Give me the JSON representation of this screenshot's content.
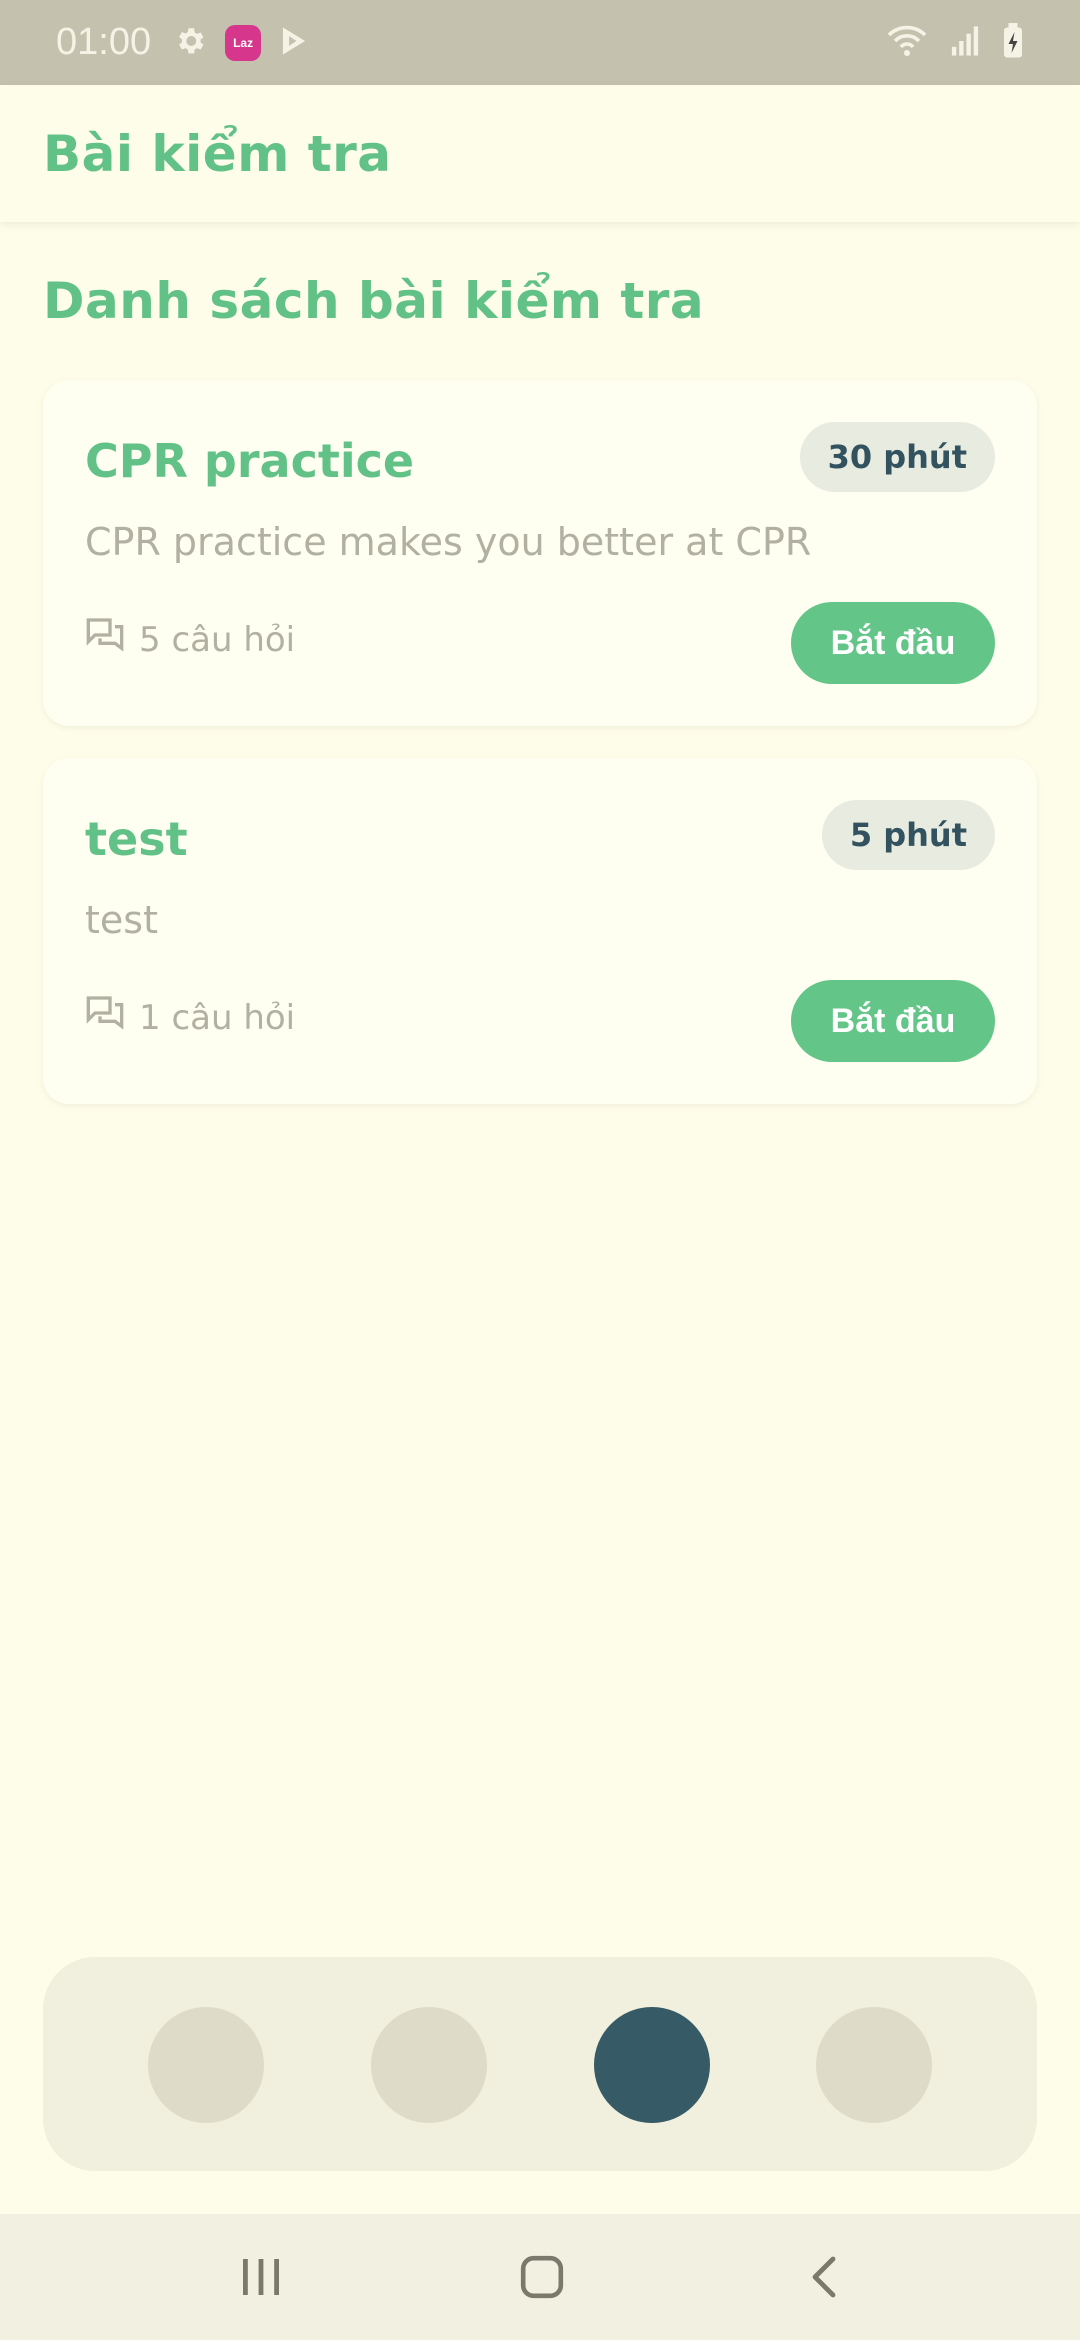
{
  "status_bar": {
    "time": "01:00",
    "left_icons": [
      "gear-icon",
      "lazada-app-icon",
      "play-store-icon"
    ],
    "lazada_label": "Laz",
    "right_icons": [
      "wifi-icon",
      "signal-icon",
      "battery-charging-icon"
    ]
  },
  "app_bar": {
    "title": "Bài kiểm tra"
  },
  "section": {
    "title": "Danh sách bài kiểm tra"
  },
  "quizzes": [
    {
      "title": "CPR practice",
      "duration": "30 phút",
      "description": "CPR practice makes you better at CPR",
      "questions": "5 câu hỏi",
      "start_label": "Bắt đầu"
    },
    {
      "title": "test",
      "duration": "5 phút",
      "description": "test",
      "questions": "1 câu hỏi",
      "start_label": "Bắt đầu"
    }
  ],
  "bottom_nav": {
    "items": 4,
    "active_index": 2
  },
  "system_nav": {
    "buttons": [
      "recents-icon",
      "home-icon",
      "back-icon"
    ]
  },
  "colors": {
    "background": "#fefde9",
    "accent_green": "#61c186",
    "button_green": "#63c587",
    "badge_text": "#33525f",
    "muted_text": "#b1b0a1",
    "nav_active": "#365b66",
    "nav_inactive": "#dedbc9"
  }
}
